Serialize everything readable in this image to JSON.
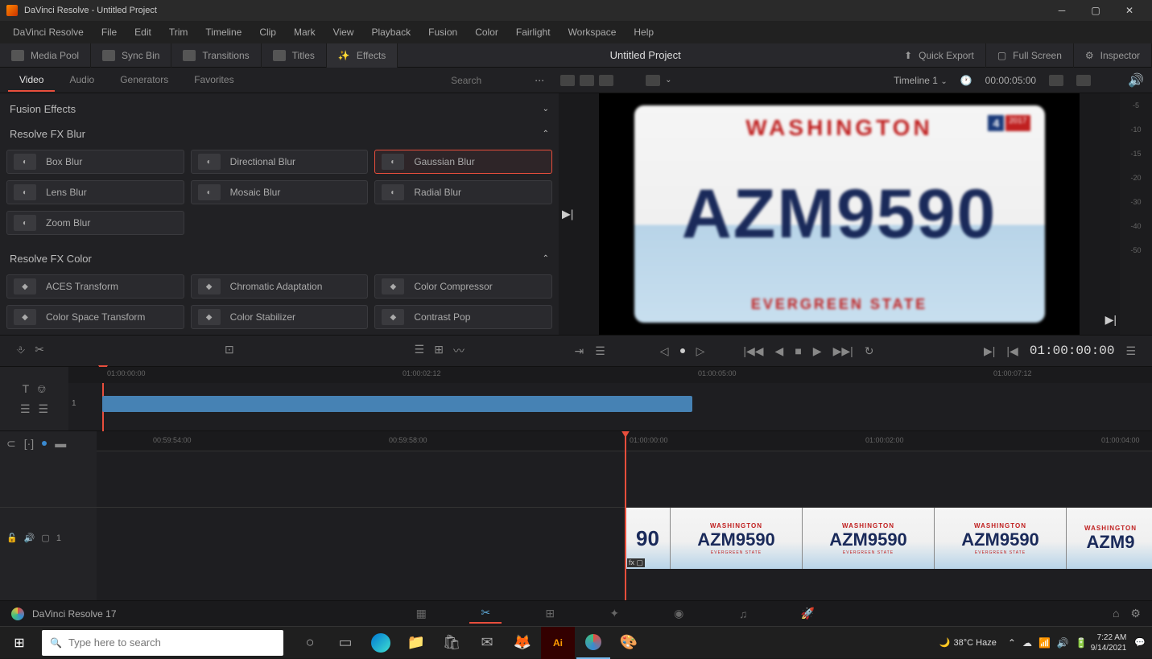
{
  "titlebar": {
    "app": "DaVinci Resolve",
    "project": "Untitled Project"
  },
  "menubar": [
    "DaVinci Resolve",
    "File",
    "Edit",
    "Trim",
    "Timeline",
    "Clip",
    "Mark",
    "View",
    "Playback",
    "Fusion",
    "Color",
    "Fairlight",
    "Workspace",
    "Help"
  ],
  "toolbar": {
    "left": [
      {
        "label": "Media Pool",
        "name": "media-pool"
      },
      {
        "label": "Sync Bin",
        "name": "sync-bin"
      },
      {
        "label": "Transitions",
        "name": "transitions"
      },
      {
        "label": "Titles",
        "name": "titles"
      },
      {
        "label": "Effects",
        "name": "effects",
        "active": true
      }
    ],
    "center": "Untitled Project",
    "right": [
      {
        "label": "Quick Export",
        "name": "quick-export"
      },
      {
        "label": "Full Screen",
        "name": "full-screen"
      },
      {
        "label": "Inspector",
        "name": "inspector"
      }
    ]
  },
  "tabs": [
    "Video",
    "Audio",
    "Generators",
    "Favorites"
  ],
  "activeTab": "Video",
  "search": {
    "placeholder": "Search"
  },
  "timelineSelector": {
    "label": "Timeline 1",
    "tc": "00:00:05:00"
  },
  "sections": {
    "fusion": {
      "title": "Fusion Effects"
    },
    "blur": {
      "title": "Resolve FX Blur",
      "items": [
        "Box Blur",
        "Directional Blur",
        "Gaussian Blur",
        "Lens Blur",
        "Mosaic Blur",
        "Radial Blur",
        "Zoom Blur"
      ],
      "selected": "Gaussian Blur"
    },
    "color": {
      "title": "Resolve FX Color",
      "items": [
        "ACES Transform",
        "Chromatic Adaptation",
        "Color Compressor",
        "Color Space Transform",
        "Color Stabilizer",
        "Contrast Pop"
      ]
    }
  },
  "plate": {
    "top": "WASHINGTON",
    "main": "AZM9590",
    "bottom": "EVERGREEN STATE",
    "badge4": "4",
    "badge2017": "2017"
  },
  "transport": {
    "tc": "01:00:00:00"
  },
  "miniRuler": [
    "01:00:00:00",
    "01:00:02:12",
    "01:00:05:00",
    "01:00:07:12"
  ],
  "tlRuler": [
    "00:59:54:00",
    "00:59:58:00",
    "01:00:00:00",
    "01:00:02:00",
    "01:00:04:00"
  ],
  "meters": [
    "-5",
    "-10",
    "-15",
    "-20",
    "-30",
    "-40",
    "-50"
  ],
  "trackLabels": {
    "v1": "1",
    "a1": "1"
  },
  "footer": {
    "version": "DaVinci Resolve 17"
  },
  "taskbar": {
    "search": "Type here to search",
    "weather": "38°C Haze",
    "time": "7:22 AM",
    "date": "9/14/2021"
  }
}
